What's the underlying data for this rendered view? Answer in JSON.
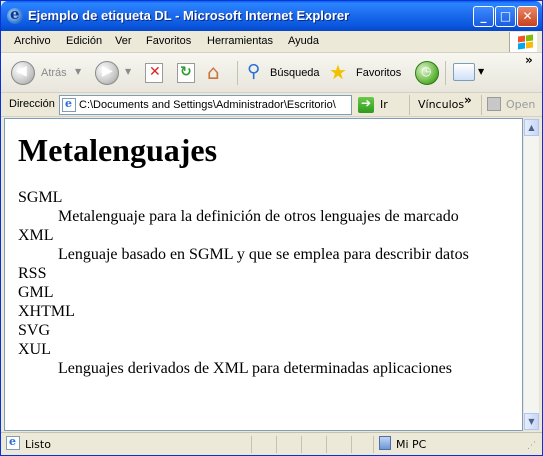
{
  "window": {
    "title": "Ejemplo de etiqueta DL - Microsoft Internet Explorer",
    "controls": {
      "minimize": "_",
      "maximize": "□",
      "close": "✕"
    }
  },
  "menubar": {
    "items": [
      "Archivo",
      "Edición",
      "Ver",
      "Favoritos",
      "Herramientas",
      "Ayuda"
    ]
  },
  "toolbar": {
    "back_label": "Atrás",
    "search_label": "Búsqueda",
    "favorites_label": "Favoritos",
    "overflow": "»"
  },
  "addressbar": {
    "label": "Dirección",
    "value": "C:\\Documents and Settings\\Administrador\\Escritorio\\",
    "go_label": "Ir",
    "links_label": "Vínculos",
    "links_overflow": "»",
    "open_label": "Open"
  },
  "page": {
    "heading": "Metalenguajes",
    "definitions": [
      {
        "type": "dt",
        "text": "SGML"
      },
      {
        "type": "dd",
        "text": "Metalenguaje para la definición de otros lenguajes de marcado"
      },
      {
        "type": "dt",
        "text": "XML"
      },
      {
        "type": "dd",
        "text": "Lenguaje basado en SGML y que se emplea para describir datos"
      },
      {
        "type": "dt",
        "text": "RSS"
      },
      {
        "type": "dt",
        "text": "GML"
      },
      {
        "type": "dt",
        "text": "XHTML"
      },
      {
        "type": "dt",
        "text": "SVG"
      },
      {
        "type": "dt",
        "text": "XUL"
      },
      {
        "type": "dd",
        "text": "Lenguajes derivados de XML para determinadas aplicaciones"
      }
    ]
  },
  "statusbar": {
    "status_text": "Listo",
    "zone_text": "Mi PC"
  },
  "colors": {
    "titlebar": "#0A58DF",
    "chrome": "#ECE9D8",
    "border": "#7F9DB9"
  }
}
